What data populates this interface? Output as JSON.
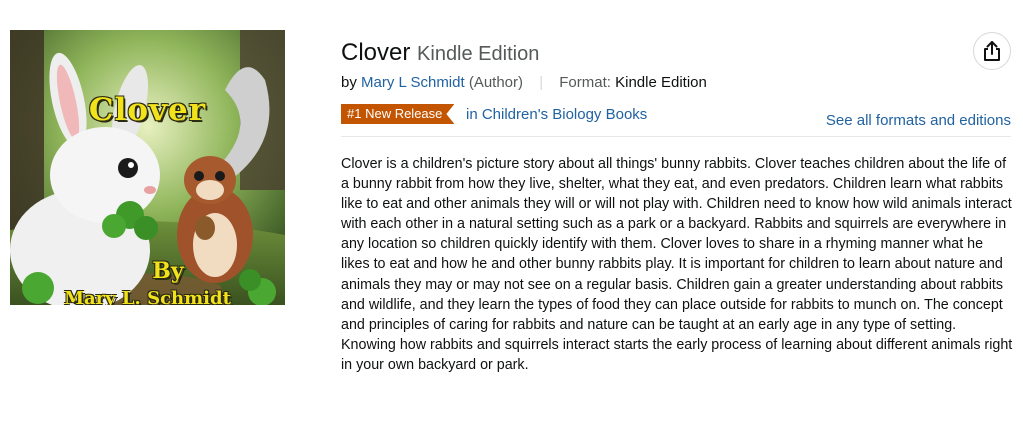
{
  "cover": {
    "title": "Clover",
    "by": "By",
    "author": "Mary L. Schmidt"
  },
  "product": {
    "title": "Clover",
    "edition": "Kindle Edition",
    "by_label": "by",
    "author": "Mary L Schmidt",
    "author_role": "(Author)",
    "format_label": "Format:",
    "format_value": "Kindle Edition"
  },
  "badge": {
    "label": "#1 New Release",
    "category_link": "in Children's Biology Books",
    "color": "#c45500"
  },
  "formats_link": "See all formats and editions",
  "description": "Clover is a children's picture story about all things' bunny rabbits. Clover teaches children about the life of a bunny rabbit from how they live, shelter, what they eat, and even predators. Children learn what rabbits like to eat and other animals they will or will not play with. Children need to know how wild animals interact with each other in a natural setting such as a park or a backyard. Rabbits and squirrels are everywhere in any location so children quickly identify with them. Clover loves to share in a rhyming manner what he likes to eat and how he and other bunny rabbits play. It is important for children to learn about nature and animals they may or may not see on a regular basis. Children gain a greater understanding about rabbits and wildlife, and they learn the types of food they can place outside for rabbits to munch on. The concept and principles of caring for rabbits and nature can be taught at an early age in any type of setting. Knowing how rabbits and squirrels interact starts the early process of learning about different animals right in your own backyard or park.",
  "icons": {
    "share": "share-icon"
  },
  "colors": {
    "link": "#2162a1",
    "text": "#0f1111",
    "muted": "#565959"
  }
}
